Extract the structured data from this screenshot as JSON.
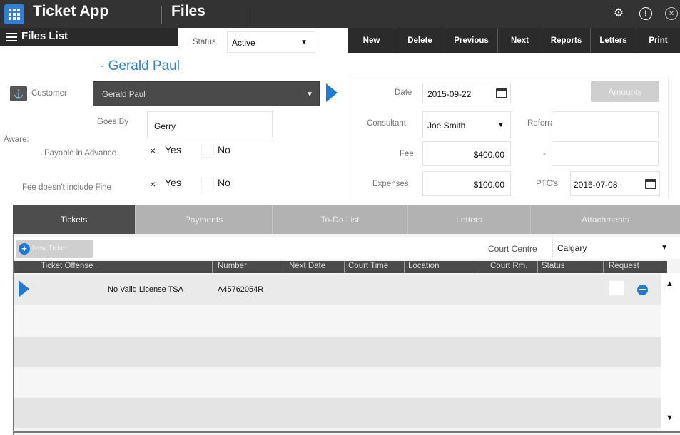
{
  "topbar": {
    "app_title": "Ticket App",
    "module_title": "Files",
    "icons": [
      "grid-icon",
      "gear-icon",
      "info-icon",
      "close-icon"
    ]
  },
  "toolbar": {
    "files_list_label": "Files List",
    "status_label": "Status",
    "status_value": "Active",
    "actions": [
      "New",
      "Delete",
      "Previous",
      "Next",
      "Reports",
      "Letters",
      "Print"
    ]
  },
  "customer": {
    "heading": "- Gerald Paul",
    "label": "Customer",
    "value": "Gerald Paul",
    "goes_by_label": "Goes By",
    "goes_by_value": "Gerry",
    "aware_label": "Aware:",
    "payable_label": "Payable in Advance",
    "fee_fine_label": "Fee doesn't include Fine",
    "yes_label": "Yes",
    "no_label": "No",
    "check_mark": "×"
  },
  "details": {
    "amounts_button": "Amounts",
    "date_label": "Date",
    "date_value": "2015-09-22",
    "consultant_label": "Consultant",
    "consultant_value": "Joe Smith",
    "referral_label": "Referral",
    "fee_label": "Fee",
    "fee_value": "$400.00",
    "dash_label": "-",
    "expenses_label": "Expenses",
    "expenses_value": "$100.00",
    "ptc_label": "PTC's",
    "ptc_value": "2016-07-08"
  },
  "tabs": [
    "Tickets",
    "Payments",
    "To-Do List",
    "Letters",
    "Attachments"
  ],
  "tickets": {
    "new_ticket_label": "New Ticket",
    "court_centre_label": "Court Centre",
    "court_centre_value": "Calgary",
    "columns": [
      "Ticket Offense",
      "Number",
      "Next Date",
      "Court Time",
      "Location",
      "Court Rm.",
      "Status",
      "Request"
    ],
    "rows": [
      {
        "offense": "No Valid License TSA",
        "number": "A45762054R"
      }
    ]
  },
  "colors": {
    "accent": "#1f7ad4",
    "topbar": "#333333",
    "customer_name": "#2a7ed6"
  }
}
